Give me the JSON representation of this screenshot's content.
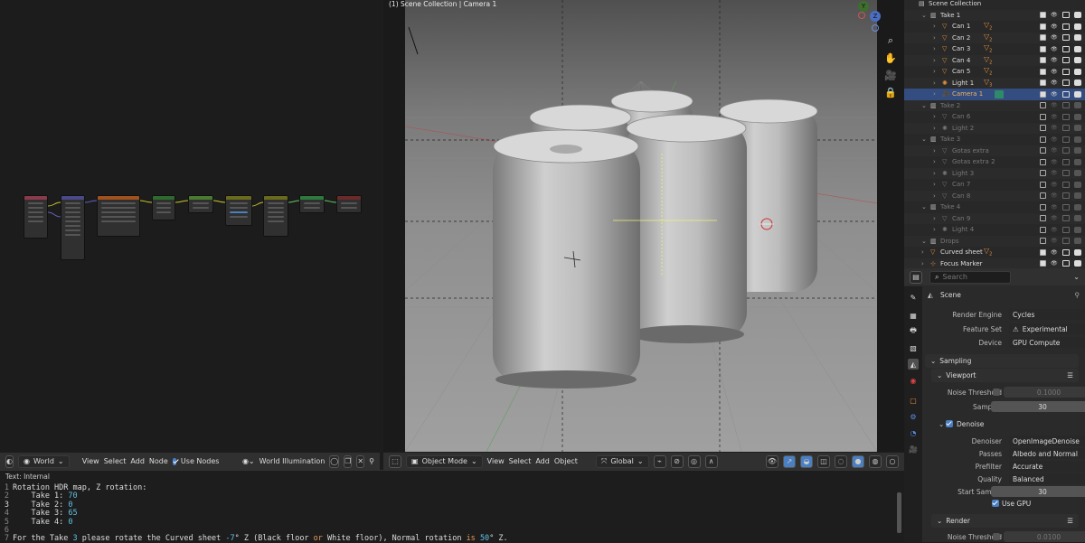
{
  "node_editor": {
    "header": {
      "editor_type_icon": "node-editor-icon",
      "shader_type": "World",
      "menus": [
        "View",
        "Select",
        "Add",
        "Node"
      ],
      "use_nodes_label": "Use Nodes",
      "world_name": "World Illumination"
    }
  },
  "viewport": {
    "overlay_text": "(1) Scene Collection | Camera 1",
    "header": {
      "mode": "Object Mode",
      "menus": [
        "View",
        "Select",
        "Add",
        "Object"
      ],
      "transform_orientation": "Global"
    },
    "gizmo": {
      "y": "Y",
      "z": "Z"
    }
  },
  "outliner": {
    "rows": [
      {
        "label": "Scene Collection",
        "type": "scene",
        "indent": 0,
        "vis": false
      },
      {
        "label": "Take 1",
        "type": "collection",
        "indent": 1,
        "vis": true
      },
      {
        "label": "Can 1",
        "type": "mesh",
        "indent": 2,
        "vis": true,
        "badge": "2"
      },
      {
        "label": "Can 2",
        "type": "mesh",
        "indent": 2,
        "vis": true,
        "badge": "2"
      },
      {
        "label": "Can 3",
        "type": "mesh",
        "indent": 2,
        "vis": true,
        "badge": "2"
      },
      {
        "label": "Can 4",
        "type": "mesh",
        "indent": 2,
        "vis": true,
        "badge": "2"
      },
      {
        "label": "Can 5",
        "type": "mesh",
        "indent": 2,
        "vis": true,
        "badge": "2"
      },
      {
        "label": "Light 1",
        "type": "light",
        "indent": 2,
        "vis": true,
        "badge": "3"
      },
      {
        "label": "Camera 1",
        "type": "camera",
        "indent": 2,
        "vis": true,
        "selected": true
      },
      {
        "label": "Take 2",
        "type": "collection",
        "indent": 1,
        "dim": true
      },
      {
        "label": "Can 6",
        "type": "mesh",
        "indent": 2,
        "dim": true
      },
      {
        "label": "Light 2",
        "type": "light",
        "indent": 2,
        "dim": true
      },
      {
        "label": "Take 3",
        "type": "collection",
        "indent": 1,
        "dim": true
      },
      {
        "label": "Gotas extra",
        "type": "mesh",
        "indent": 2,
        "dim": true
      },
      {
        "label": "Gotas extra 2",
        "type": "mesh",
        "indent": 2,
        "dim": true
      },
      {
        "label": "Light 3",
        "type": "light",
        "indent": 2,
        "dim": true
      },
      {
        "label": "Can 7",
        "type": "mesh",
        "indent": 2,
        "dim": true
      },
      {
        "label": "Can 8",
        "type": "mesh",
        "indent": 2,
        "dim": true
      },
      {
        "label": "Take 4",
        "type": "collection",
        "indent": 1,
        "dim": true
      },
      {
        "label": "Can 9",
        "type": "mesh",
        "indent": 2,
        "dim": true
      },
      {
        "label": "Light 4",
        "type": "light",
        "indent": 2,
        "dim": true
      },
      {
        "label": "Drops",
        "type": "collection",
        "indent": 1,
        "dim": true
      },
      {
        "label": "Curved sheet",
        "type": "mesh",
        "indent": 1,
        "vis": true,
        "badge": "2"
      },
      {
        "label": "Focus Marker",
        "type": "empty",
        "indent": 1,
        "vis": true
      }
    ]
  },
  "properties": {
    "search_placeholder": "Search",
    "context": "Scene",
    "render_engine_label": "Render Engine",
    "render_engine": "Cycles",
    "feature_set_label": "Feature Set",
    "feature_set": "Experimental",
    "device_label": "Device",
    "device": "GPU Compute",
    "sampling_panel": "Sampling",
    "viewport_panel": "Viewport",
    "noise_threshold_label": "Noise Threshold",
    "noise_threshold": "0.1000",
    "samples_label": "Samples",
    "samples": "30",
    "denoise_panel": "Denoise",
    "denoiser_label": "Denoiser",
    "denoiser": "OpenImageDenoise",
    "passes_label": "Passes",
    "passes": "Albedo and Normal",
    "prefilter_label": "Prefilter",
    "prefilter": "Accurate",
    "quality_label": "Quality",
    "quality": "Balanced",
    "start_sample_label": "Start Sample",
    "start_sample": "30",
    "use_gpu_label": "Use GPU",
    "render_panel": "Render",
    "render_noise_threshold_label": "Noise Threshold",
    "render_noise_threshold": "0.0100"
  },
  "text_editor": {
    "header": "Text: Internal",
    "lines": [
      {
        "n": "1",
        "parts": [
          {
            "t": "Rotation HDR map, Z rotation:",
            "c": "pl"
          }
        ]
      },
      {
        "n": "2",
        "parts": [
          {
            "t": "    Take 1: ",
            "c": "pl"
          },
          {
            "t": "70",
            "c": "nm"
          }
        ]
      },
      {
        "n": "3",
        "parts": [
          {
            "t": "    Take 2: ",
            "c": "pl"
          },
          {
            "t": "0",
            "c": "nm"
          }
        ]
      },
      {
        "n": "4",
        "parts": [
          {
            "t": "    Take 3: ",
            "c": "pl"
          },
          {
            "t": "65",
            "c": "nm"
          }
        ]
      },
      {
        "n": "5",
        "parts": [
          {
            "t": "    Take 4: ",
            "c": "pl"
          },
          {
            "t": "0",
            "c": "nm"
          }
        ]
      },
      {
        "n": "6",
        "parts": []
      },
      {
        "n": "7",
        "parts": [
          {
            "t": "For the Take ",
            "c": "pl"
          },
          {
            "t": "3",
            "c": "nm"
          },
          {
            "t": " please rotate the Curved sheet ",
            "c": "pl"
          },
          {
            "t": "-7",
            "c": "nm"
          },
          {
            "t": "° Z (Black floor ",
            "c": "pl"
          },
          {
            "t": "or",
            "c": "kw"
          },
          {
            "t": " White floor), Normal rotation ",
            "c": "pl"
          },
          {
            "t": "is",
            "c": "kw"
          },
          {
            "t": " ",
            "c": "pl"
          },
          {
            "t": "50",
            "c": "nm"
          },
          {
            "t": "° Z.",
            "c": "pl"
          }
        ]
      }
    ]
  },
  "colors": {
    "accent": "#4a7fc2",
    "selection": "#334d80",
    "mesh_icon": "#e2913f"
  }
}
